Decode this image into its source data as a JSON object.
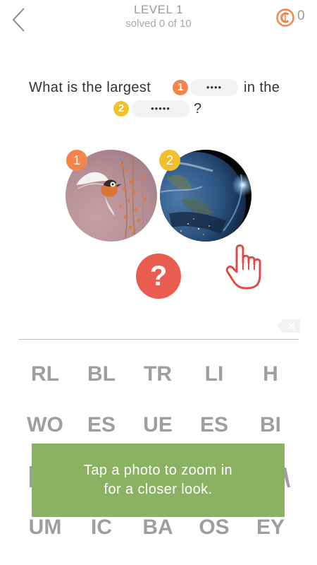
{
  "header": {
    "title": "LEVEL 1",
    "subtitle": "solved 0 of 10",
    "coins": "0"
  },
  "question": {
    "part1": "What is the largest",
    "num1": "1",
    "blank1": "••••",
    "part2": "in the",
    "num2": "2",
    "blank2": "•••••",
    "part3": "?"
  },
  "photos": [
    {
      "badge": "1",
      "subject": "bird"
    },
    {
      "badge": "2",
      "subject": "planet earth"
    }
  ],
  "hint_label": "?",
  "letters": [
    [
      "RL",
      "BL",
      "TR",
      "LI",
      "H"
    ],
    [
      "WO",
      "ES",
      "UE",
      "ES",
      "BI"
    ],
    [
      "",
      "",
      "",
      "",
      ""
    ],
    [
      "UM",
      "IC",
      "BA",
      "OS",
      "EY"
    ]
  ],
  "toast": {
    "line1": "Tap a photo to zoom in",
    "line2": "for a closer look."
  },
  "colors": {
    "orange": "#f4854a",
    "yellow": "#f2c02d",
    "red": "#ea5b50",
    "green": "#8bb163",
    "coin": "#f4854a"
  }
}
